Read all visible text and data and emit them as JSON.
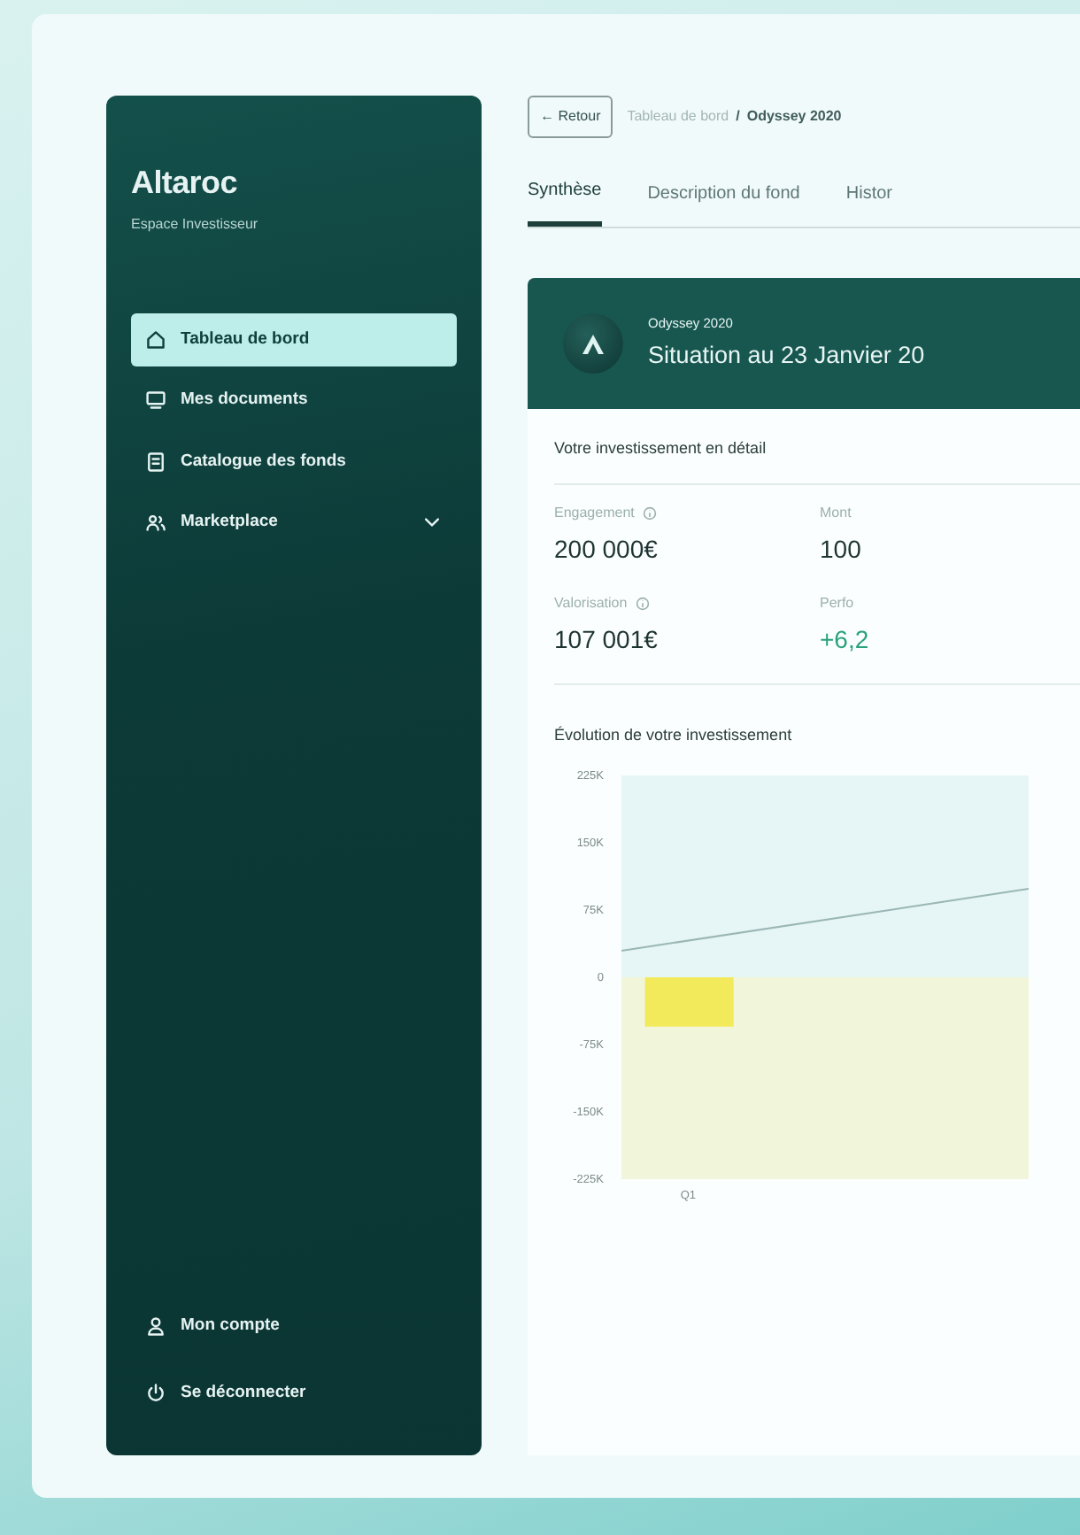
{
  "sidebar": {
    "logo": "Altaroc",
    "subtitle": "Espace Investisseur",
    "items": [
      {
        "label": "Tableau de bord",
        "selected": true
      },
      {
        "label": "Mes documents",
        "selected": false
      },
      {
        "label": "Catalogue des fonds",
        "selected": false
      },
      {
        "label": "Marketplace",
        "selected": false,
        "expandable": true
      }
    ],
    "footer_items": [
      {
        "label": "Mon compte"
      },
      {
        "label": "Se déconnecter"
      }
    ]
  },
  "back_arrow": "←",
  "back_button": "Retour",
  "breadcrumb_separator": "/",
  "breadcrumb": [
    {
      "label": "Tableau de bord",
      "current": false
    },
    {
      "label": "Odyssey 2020",
      "current": true
    }
  ],
  "tabs": [
    {
      "label": "Synthèse",
      "selected": true
    },
    {
      "label": "Description du fond",
      "selected": false
    },
    {
      "label": "Histor",
      "selected": false
    }
  ],
  "header": {
    "fund": "Odyssey 2020",
    "title": "Situation au 23 Janvier 20"
  },
  "detail": {
    "title": "Votre investissement en détail",
    "metrics": [
      {
        "label": "Engagement",
        "info": true,
        "value": "200 000€",
        "positive": false
      },
      {
        "label": "Mont",
        "info": false,
        "value": "100",
        "positive": false
      },
      {
        "label": "Valorisation",
        "info": true,
        "value": "107 001€",
        "positive": false
      },
      {
        "label": "Perfo",
        "info": false,
        "value": "+6,2",
        "positive": true
      }
    ]
  },
  "evolution": {
    "title": "Évolution de votre investissement",
    "chart_data": {
      "type": "bar",
      "categories": [
        "Q1"
      ],
      "series": [
        {
          "type": "bar",
          "color": "#f2ea5a",
          "values": [
            -55000
          ]
        }
      ],
      "ylim": [
        -225000,
        225000
      ],
      "yticks": [
        {
          "value": 225000,
          "label": "225K"
        },
        {
          "value": 150000,
          "label": "150K"
        },
        {
          "value": 75000,
          "label": "75K"
        },
        {
          "value": 0,
          "label": "0"
        },
        {
          "value": -75000,
          "label": "-75K"
        },
        {
          "value": -150000,
          "label": "-150K"
        },
        {
          "value": -225000,
          "label": "-225K"
        }
      ]
    }
  }
}
